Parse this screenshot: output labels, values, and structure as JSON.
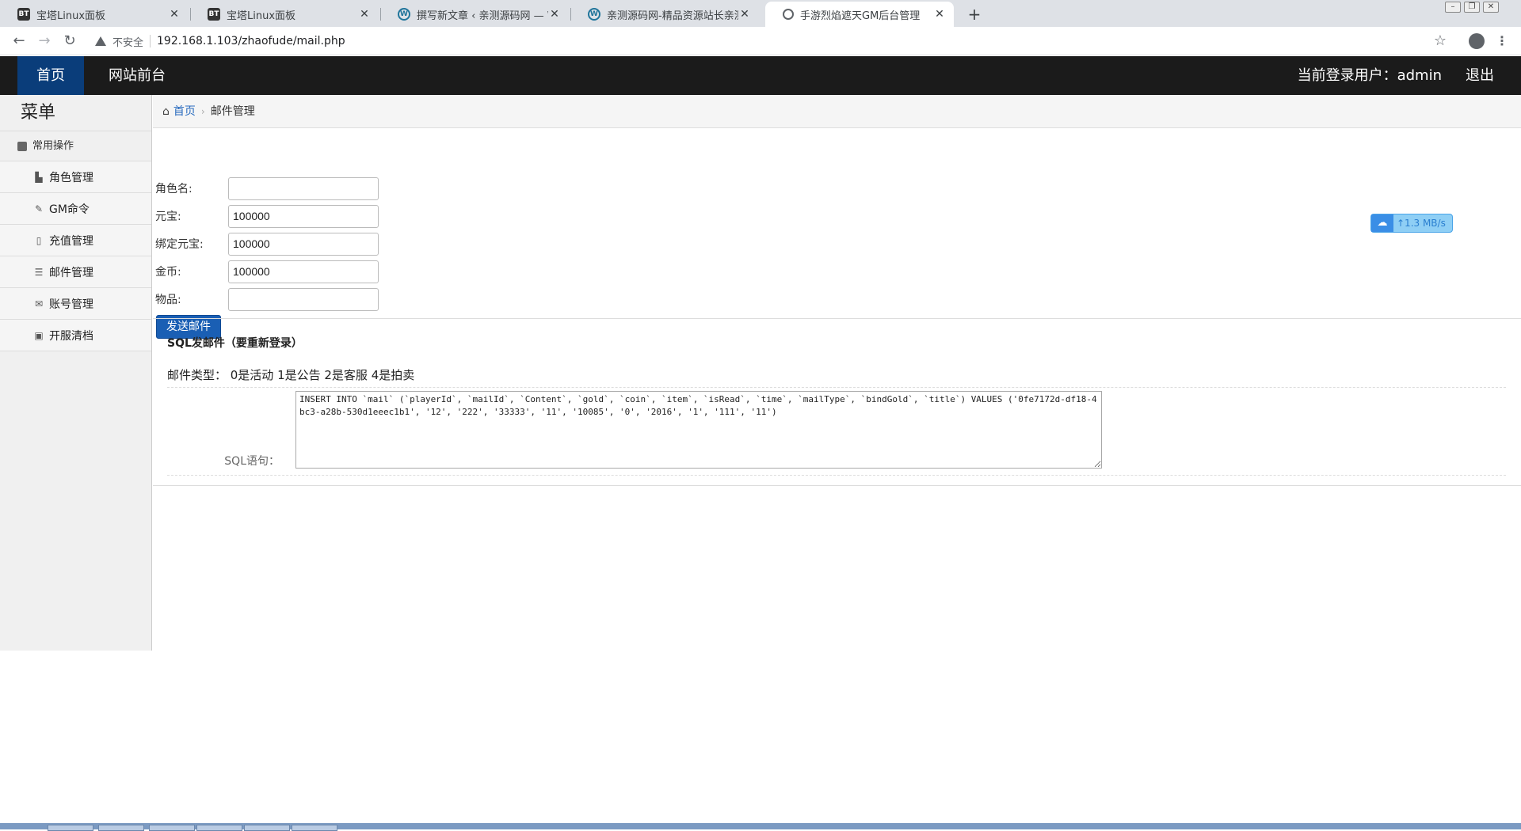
{
  "browser": {
    "tabs": [
      {
        "title": "宝塔Linux面板",
        "icon": "bt-icon",
        "active": false
      },
      {
        "title": "宝塔Linux面板",
        "icon": "bt-icon",
        "active": false
      },
      {
        "title": "撰写新文章 ‹ 亲测源码网 — Wo",
        "icon": "wordpress-icon",
        "active": false
      },
      {
        "title": "亲测源码网-精品资源站长亲测",
        "icon": "wordpress-icon",
        "active": false
      },
      {
        "title": "手游烈焰遮天GM后台管理",
        "icon": "globe-icon",
        "active": true
      }
    ],
    "new_tab": "+",
    "security_label": "不安全",
    "url": "192.168.1.103/zhaofude/mail.php"
  },
  "topnav": {
    "home": "首页",
    "frontend": "网站前台",
    "user_label": "当前登录用户：admin",
    "logout": "退出"
  },
  "sidebar": {
    "title": "菜单",
    "group": "常用操作",
    "items": [
      {
        "label": "角色管理",
        "icon": "users-icon"
      },
      {
        "label": "GM命令",
        "icon": "wrench-icon"
      },
      {
        "label": "充值管理",
        "icon": "file-icon"
      },
      {
        "label": "邮件管理",
        "icon": "list-icon"
      },
      {
        "label": "账号管理",
        "icon": "envelope-icon"
      },
      {
        "label": "开服清档",
        "icon": "picture-icon"
      }
    ]
  },
  "breadcrumb": {
    "home": "首页",
    "current": "邮件管理"
  },
  "form": {
    "fields": [
      {
        "label": "角色名:",
        "value": ""
      },
      {
        "label": "元宝:",
        "value": "100000"
      },
      {
        "label": "绑定元宝:",
        "value": "100000"
      },
      {
        "label": "金币:",
        "value": "100000"
      },
      {
        "label": "物品:",
        "value": ""
      }
    ],
    "submit": "发送邮件"
  },
  "speed_widget": {
    "text": "↑1.3 MB/s"
  },
  "sql": {
    "title": "SQL发邮件（要重新登录）",
    "mail_types": "邮件类型： 0是活动 1是公告 2是客服 4是拍卖",
    "label": "SQL语句：",
    "statement": "INSERT INTO `mail` (`playerId`, `mailId`, `Content`, `gold`, `coin`, `item`, `isRead`, `time`, `mailType`, `bindGold`, `title`) VALUES ('0fe7172d-df18-4bc3-a28b-530d1eeec1b1', '12', '222', '33333', '11', '10085', '0', '2016', '1', '111', '11')"
  }
}
